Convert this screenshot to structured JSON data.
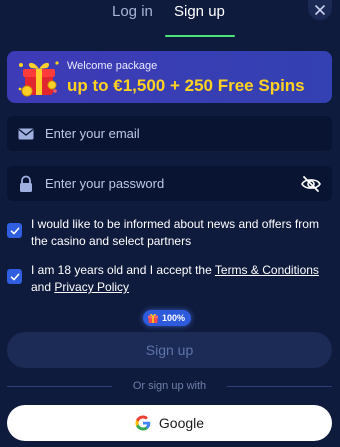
{
  "tabs": {
    "login_label": "Log in",
    "signup_label": "Sign up",
    "active": "signup"
  },
  "promo": {
    "small_label": "Welcome package",
    "big_label": "up to €1,500 + 250 Free Spins"
  },
  "email": {
    "placeholder": "Enter your email",
    "icon": "envelope-icon"
  },
  "password": {
    "placeholder": "Enter your password",
    "icon": "lock-icon",
    "toggle_icon": "eye-slash-icon"
  },
  "checkboxes": {
    "news_label": "I would like to be informed about news and offers from the casino and select partners",
    "age_prefix": "I am 18 years old and I accept the ",
    "terms_link": "Terms & Conditions",
    "age_and": " and ",
    "privacy_link": "Privacy Policy",
    "news_checked": true,
    "age_checked": true
  },
  "badge": {
    "label": "100%"
  },
  "signup_button": {
    "label": "Sign up"
  },
  "divider": {
    "label": "Or sign up with"
  },
  "google_button": {
    "label": "Google"
  },
  "colors": {
    "background": "#0f1b3d",
    "accent_green": "#4ee37a",
    "promo_yellow": "#ffd21f",
    "checkbox_blue": "#2f5fe0"
  }
}
